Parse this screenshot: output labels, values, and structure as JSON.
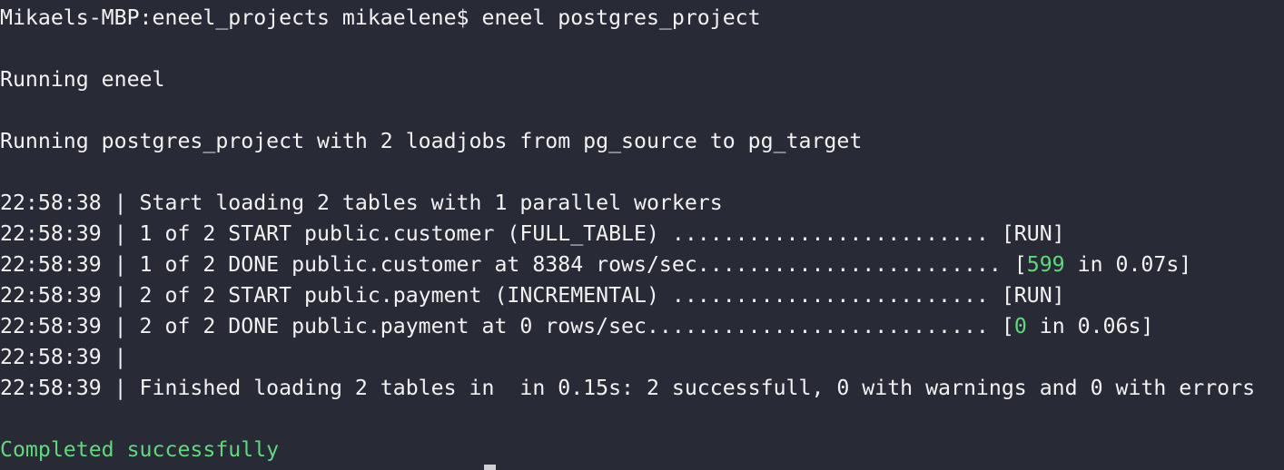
{
  "terminal": {
    "prompt": "Mikaels-MBP:eneel_projects mikaelene$ eneel postgres_project",
    "running": "Running eneel",
    "running_project": "Running postgres_project with 2 loadjobs from pg_source to pg_target",
    "log": [
      "22:58:38 | Start loading 2 tables with 1 parallel workers",
      "22:58:39 | 1 of 2 START public.customer (FULL_TABLE) ......................... [RUN]"
    ],
    "done1": {
      "prefix": "22:58:39 | 1 of 2 DONE public.customer at 8384 rows/sec........................ [",
      "rows": "599",
      "suffix": " in 0.07s]"
    },
    "start2": "22:58:39 | 2 of 2 START public.payment (INCREMENTAL) ......................... [RUN]",
    "done2": {
      "prefix": "22:58:39 | 2 of 2 DONE public.payment at 0 rows/sec........................... [",
      "rows": "0",
      "suffix": " in 0.06s]"
    },
    "blank_log": "22:58:39 |",
    "finished": "22:58:39 | Finished loading 2 tables in  in 0.15s: 2 successfull, 0 with warnings and 0 with errors",
    "completed": "Completed successfully"
  },
  "colors": {
    "background": "#282a36",
    "text": "#f2f2f2",
    "success": "#5fd97c"
  }
}
